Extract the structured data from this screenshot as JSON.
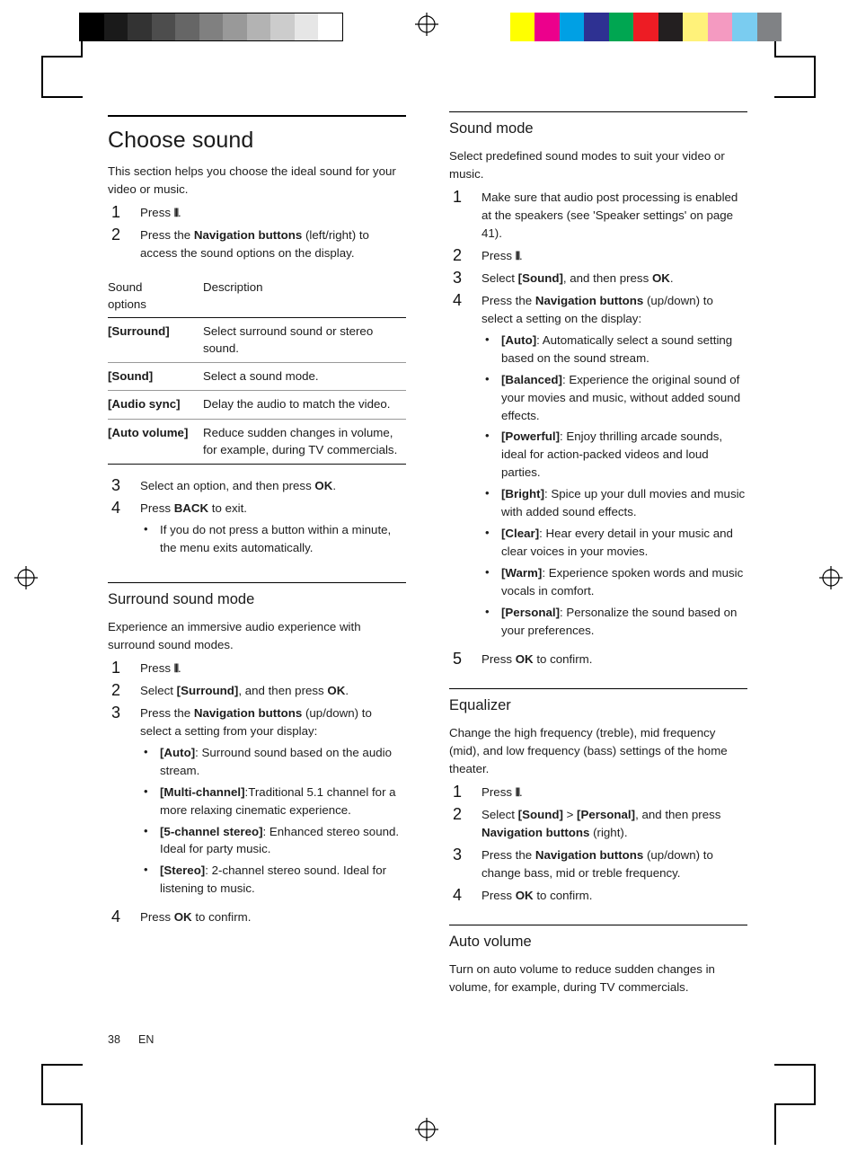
{
  "marks": {
    "grey_steps": [
      "#000000",
      "#1a1a1a",
      "#333333",
      "#4d4d4d",
      "#666666",
      "#808080",
      "#999999",
      "#b3b3b3",
      "#cccccc",
      "#e6e6e6",
      "#ffffff"
    ],
    "color_patches": [
      "#ffff00",
      "#ec008c",
      "#00a0e4",
      "#2e3192",
      "#00a651",
      "#ed1c24",
      "#231f20",
      "#fff27a",
      "#f49ac1",
      "#7accf0",
      "#808285"
    ]
  },
  "left": {
    "title": "Choose sound",
    "intro": "This section helps you choose the ideal sound for your video or music.",
    "steps_top": [
      {
        "num": "1",
        "pre": "Press ",
        "icon": "equalizer-icon",
        "post": "."
      },
      {
        "num": "2",
        "pre": "Press the ",
        "bold": "Navigation buttons",
        "post": " (left/right) to access the sound options on the display."
      }
    ],
    "table": {
      "headers": [
        "Sound options",
        "Description"
      ],
      "header_line1": "Sound",
      "header_line2": "options",
      "rows": [
        {
          "option": "[Surround]",
          "desc": "Select surround sound or stereo sound."
        },
        {
          "option": "[Sound]",
          "desc": "Select a sound mode."
        },
        {
          "option": "[Audio sync]",
          "desc": "Delay the audio to match the video."
        },
        {
          "option": "[Auto volume]",
          "desc": "Reduce sudden changes in volume, for example, during TV commercials."
        }
      ]
    },
    "steps_bottom": [
      {
        "num": "3",
        "pre": "Select an option, and then press ",
        "bold": "OK",
        "post": "."
      },
      {
        "num": "4",
        "pre": "Press ",
        "bold": "BACK",
        "post": " to exit."
      }
    ],
    "step4_bullet": "If you do not press a button within a minute, the menu exits automatically.",
    "surround": {
      "heading": "Surround sound mode",
      "intro": "Experience an immersive audio experience with surround sound modes.",
      "steps": [
        {
          "num": "1",
          "pre": "Press ",
          "icon": "equalizer-icon",
          "post": "."
        },
        {
          "num": "2",
          "pre": "Select ",
          "bold": "[Surround]",
          "post": ", and then press ",
          "bold2": "OK",
          "post2": "."
        },
        {
          "num": "3",
          "pre": "Press the ",
          "bold": "Navigation buttons",
          "post": " (up/down) to select a setting from your display:"
        },
        {
          "num": "4",
          "pre": "Press ",
          "bold": "OK",
          "post": " to confirm."
        }
      ],
      "bullets": [
        {
          "term": "[Auto]",
          "text": ": Surround sound based on the audio stream."
        },
        {
          "term": "[Multi-channel]",
          "text": ":Traditional 5.1 channel for a more relaxing cinematic experience."
        },
        {
          "term": "[5-channel stereo]",
          "text": ": Enhanced stereo sound. Ideal for party music."
        },
        {
          "term": "[Stereo]",
          "text": ": 2-channel stereo sound. Ideal for listening to music."
        }
      ]
    }
  },
  "right": {
    "sound_mode": {
      "heading": "Sound mode",
      "intro": "Select predefined sound modes to suit your video or music.",
      "steps": [
        {
          "num": "1",
          "text": "Make sure that audio post processing is enabled at the speakers (see 'Speaker settings' on page 41)."
        },
        {
          "num": "2",
          "pre": "Press ",
          "icon": "equalizer-icon",
          "post": "."
        },
        {
          "num": "3",
          "pre": "Select ",
          "bold": "[Sound]",
          "post": ", and then press ",
          "bold2": "OK",
          "post2": "."
        },
        {
          "num": "4",
          "pre": "Press the ",
          "bold": "Navigation buttons",
          "post": " (up/down) to select a setting on the display:"
        },
        {
          "num": "5",
          "pre": "Press ",
          "bold": "OK",
          "post": " to confirm."
        }
      ],
      "bullets": [
        {
          "term": "[Auto]",
          "text": ": Automatically select a sound setting based on the sound stream."
        },
        {
          "term": "[Balanced]",
          "text": ": Experience the original sound of your movies and music, without added sound effects."
        },
        {
          "term": "[Powerful]",
          "text": ": Enjoy thrilling arcade sounds, ideal for action-packed videos and loud parties."
        },
        {
          "term": "[Bright]",
          "text": ": Spice up your dull movies and music with added sound effects."
        },
        {
          "term": "[Clear]",
          "text": ": Hear every detail in your music and clear voices in your movies."
        },
        {
          "term": "[Warm]",
          "text": ": Experience spoken words and music vocals in comfort."
        },
        {
          "term": "[Personal]",
          "text": ": Personalize the sound based on your preferences."
        }
      ]
    },
    "equalizer": {
      "heading": "Equalizer",
      "intro": "Change the high frequency (treble), mid frequency (mid), and low frequency (bass) settings of the home theater.",
      "steps": [
        {
          "num": "1",
          "pre": "Press ",
          "icon": "equalizer-icon",
          "post": "."
        },
        {
          "num": "2",
          "pre": "Select ",
          "bold": "[Sound]",
          "mid": " > ",
          "bold2": "[Personal]",
          "post": ", and then press ",
          "bold3": "Navigation buttons",
          "post2": " (right)."
        },
        {
          "num": "3",
          "pre": "Press the ",
          "bold": "Navigation buttons",
          "post": " (up/down) to change bass, mid or treble frequency."
        },
        {
          "num": "4",
          "pre": "Press ",
          "bold": "OK",
          "post": " to confirm."
        }
      ]
    },
    "auto_volume": {
      "heading": "Auto volume",
      "intro": "Turn on auto volume to reduce sudden changes in volume, for example, during TV commercials."
    }
  },
  "footer": {
    "page_number": "38",
    "language": "EN"
  }
}
